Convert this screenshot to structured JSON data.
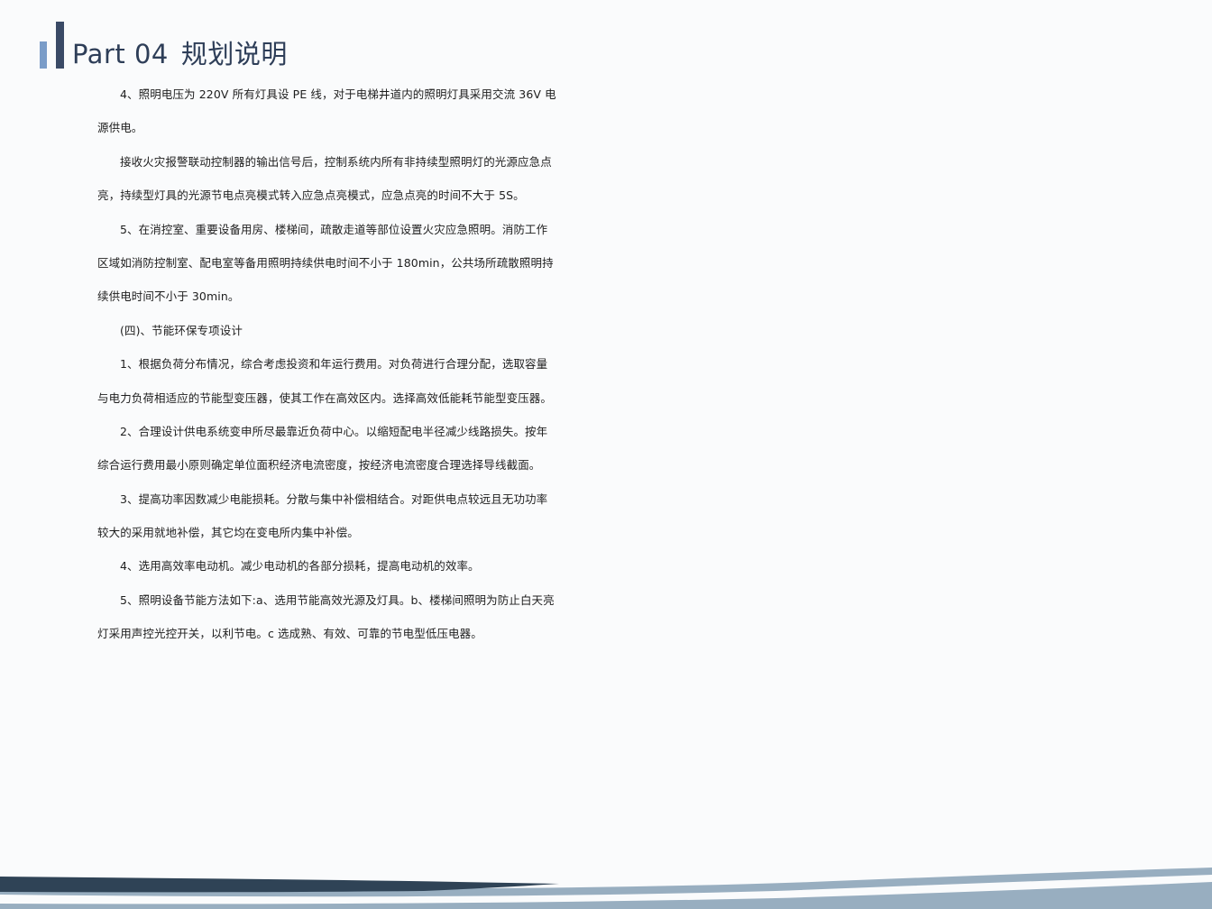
{
  "header": {
    "part": "Part 04",
    "title": "规划说明"
  },
  "body_lines": [
    {
      "text": "4、照明电压为 220V 所有灯具设 PE 线，对于电梯井道内的照明灯具采用交流 36V 电",
      "indent": true
    },
    {
      "text": "源供电。",
      "indent": false
    },
    {
      "text": "接收火灾报警联动控制器的输出信号后，控制系统内所有非持续型照明灯的光源应急点",
      "indent": true
    },
    {
      "text": "亮，持续型灯具的光源节电点亮模式转入应急点亮模式，应急点亮的时间不大于 5S。",
      "indent": false
    },
    {
      "text": "5、在消控室、重要设备用房、楼梯间，疏散走道等部位设置火灾应急照明。消防工作",
      "indent": true
    },
    {
      "text": "区域如消防控制室、配电室等备用照明持续供电时间不小于 180min，公共场所疏散照明持",
      "indent": false
    },
    {
      "text": "续供电时间不小于 30min。",
      "indent": false
    },
    {
      "text": "(四)、节能环保专项设计",
      "indent": true
    },
    {
      "text": "1、根据负荷分布情况，综合考虑投资和年运行费用。对负荷进行合理分配，选取容量",
      "indent": true
    },
    {
      "text": "与电力负荷相适应的节能型变压器，使其工作在高效区内。选择高效低能耗节能型变压器。",
      "indent": false
    },
    {
      "text": "2、合理设计供电系统变申所尽最靠近负荷中心。以缩短配电半径减少线路损失。按年",
      "indent": true
    },
    {
      "text": "综合运行费用最小原则确定单位面积经济电流密度，按经济电流密度合理选择导线截面。",
      "indent": false
    },
    {
      "text": "3、提高功率因数减少电能损耗。分散与集中补偿相结合。对距供电点较远且无功功率",
      "indent": true
    },
    {
      "text": "较大的采用就地补偿，其它均在变电所内集中补偿。",
      "indent": false
    },
    {
      "text": "4、选用高效率电动机。减少电动机的各部分损耗，提高电动机的效率。",
      "indent": true
    },
    {
      "text": "5、照明设备节能方法如下:a、选用节能高效光源及灯具。b、楼梯间照明为防止白天亮",
      "indent": true
    },
    {
      "text": "灯采用声控光控开关，以利节电。c 选成熟、有效、可靠的节电型低压电器。",
      "indent": false
    }
  ],
  "colors": {
    "accent_light": "#7a9cc8",
    "accent_dark": "#3a4a66",
    "title": "#2e3e58",
    "wave_dark": "#2f4356",
    "wave_mid": "#5f7c93",
    "wave_light": "#98aec0"
  }
}
